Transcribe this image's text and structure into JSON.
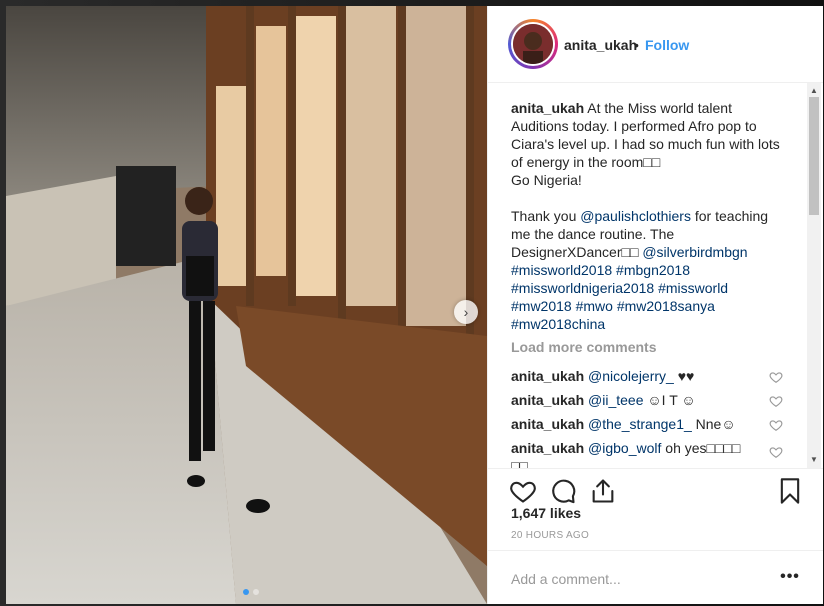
{
  "post": {
    "username": "anita_ukah",
    "separator": "•",
    "follow_label": "Follow",
    "caption": {
      "user": "anita_ukah",
      "lines": [
        " At the Miss world talent",
        "Auditions today. I performed Afro pop to",
        "Ciara's level up. I had so much fun with lots",
        "of energy in the room□□",
        "Go Nigeria!",
        "",
        "Thank you ",
        "me the dance routine. The",
        "DesignerXDancer□□ "
      ],
      "mention_paulish": "@paulishclothiers",
      "thanks_tail": " for teaching",
      "mention_silverbird": "@silverbirdmbgn",
      "hashtags_line1": "#missworld2018 #mbgn2018",
      "hashtags_line2": "#missworldnigeria2018 #missworld",
      "hashtags_line3": "#mw2018 #mwo #mw2018sanya",
      "hashtags_line4": "#mw2018china"
    },
    "load_more": "Load more comments",
    "comments": [
      {
        "user": "anita_ukah",
        "mention": "@nicolejerry_",
        "text": " ♥♥"
      },
      {
        "user": "anita_ukah",
        "mention": "@ii_teee",
        "text": " ☺I T ☺"
      },
      {
        "user": "anita_ukah",
        "mention": "@the_strange1_",
        "text": " Nne☺"
      },
      {
        "user": "anita_ukah",
        "mention": "@igbo_wolf",
        "text": " oh yes□□□□"
      },
      {
        "user": "",
        "mention": "",
        "text": "□□"
      }
    ],
    "likes": "1,647 likes",
    "time_ago": "20 HOURS AGO",
    "add_comment_placeholder": "Add a comment...",
    "more_options": "•••",
    "carousel_next": "›"
  },
  "icons": [
    "heart-icon",
    "comment-icon",
    "share-icon",
    "bookmark-icon",
    "chevron-right-icon"
  ],
  "colors": {
    "link": "#003569",
    "follow": "#3897f0",
    "muted": "#999999",
    "text": "#262626"
  }
}
